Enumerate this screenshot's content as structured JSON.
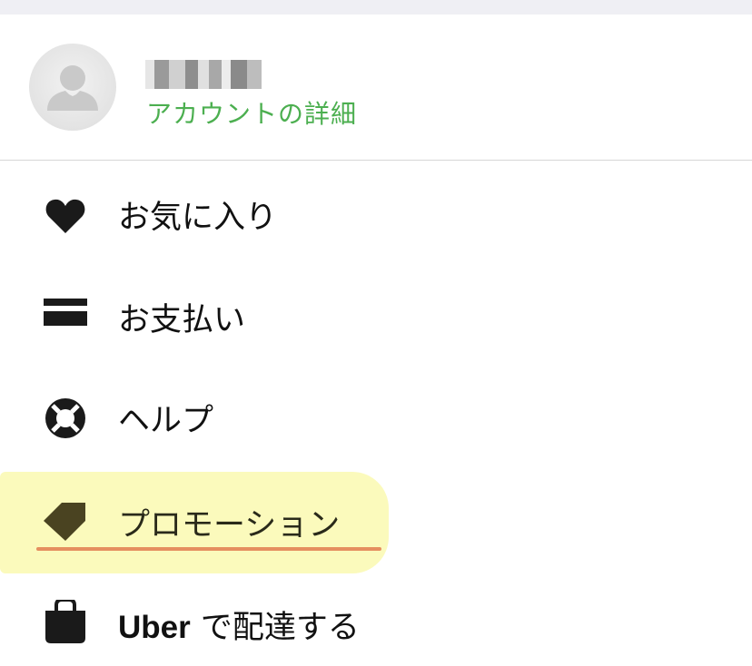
{
  "account": {
    "link_label": "アカウントの詳細",
    "link_color": "#4caf50",
    "avatar_icon": "person-silhouette-icon"
  },
  "menu": {
    "items": [
      {
        "label": "お気に入り",
        "icon": "heart-icon"
      },
      {
        "label": "お支払い",
        "icon": "credit-card-icon"
      },
      {
        "label": "ヘルプ",
        "icon": "lifebuoy-icon"
      },
      {
        "label": "プロモーション",
        "icon": "tag-icon"
      },
      {
        "label_bold": "Uber",
        "label_rest": " で配達する",
        "icon": "shopping-bag-icon"
      }
    ]
  },
  "annotation": {
    "highlight_color": "#fbfab8",
    "underline_color": "#e07b4f"
  }
}
